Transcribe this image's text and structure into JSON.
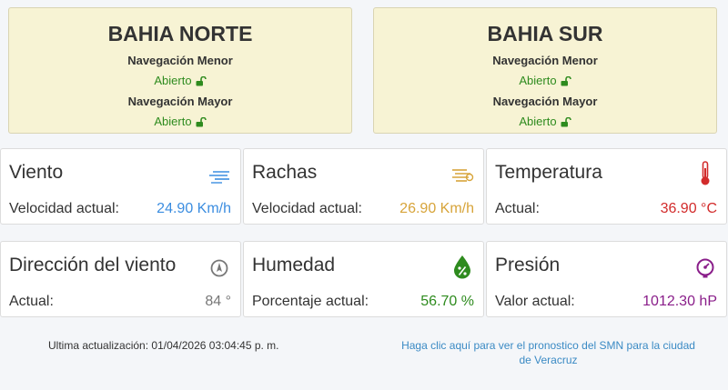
{
  "harbors": [
    {
      "name": "BAHIA NORTE",
      "minor_label": "Navegación Menor",
      "minor_status": "Abierto",
      "major_label": "Navegación Mayor",
      "major_status": "Abierto"
    },
    {
      "name": "BAHIA SUR",
      "minor_label": "Navegación Menor",
      "minor_status": "Abierto",
      "major_label": "Navegación Mayor",
      "major_status": "Abierto"
    }
  ],
  "cards": {
    "wind": {
      "title": "Viento",
      "label": "Velocidad actual:",
      "value": "24.90 Km/h",
      "icon": "wind-icon",
      "color": "#3b8de0"
    },
    "gusts": {
      "title": "Rachas",
      "label": "Velocidad actual:",
      "value": "26.90 Km/h",
      "icon": "gusts-icon",
      "color": "#d7a43a"
    },
    "temperature": {
      "title": "Temperatura",
      "label": "Actual:",
      "value": "36.90 °C",
      "icon": "thermometer-icon",
      "color": "#d22b2b"
    },
    "direction": {
      "title": "Dirección del viento",
      "label": "Actual:",
      "value": "84 °",
      "icon": "compass-icon",
      "color": "#777777"
    },
    "humidity": {
      "title": "Humedad",
      "label": "Porcentaje actual:",
      "value": "56.70 %",
      "icon": "humidity-drop-icon",
      "color": "#2e8b1e"
    },
    "pressure": {
      "title": "Presión",
      "label": "Valor actual:",
      "value": "1012.30 hP",
      "icon": "barometer-icon",
      "color": "#8a1e8a"
    }
  },
  "footer": {
    "updated_label": "Ultima actualización:",
    "updated_value": "01/04/2026 03:04:45 p. m.",
    "smn_link_line1": "Haga clic aquí para ver el pronostico del SMN para la ciudad",
    "smn_link_line2": "de Veracruz"
  },
  "colors": {
    "open_status": "#2e8b1e",
    "harbor_bg": "#f7f3d4",
    "link": "#3a8ac4"
  }
}
